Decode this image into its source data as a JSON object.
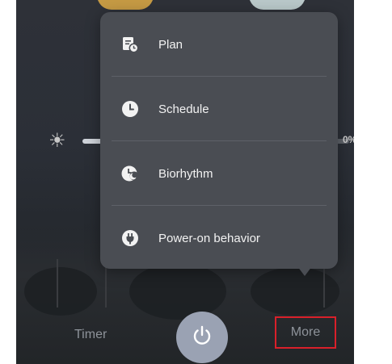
{
  "menu": {
    "items": [
      {
        "label": "Plan",
        "icon": "plan-icon"
      },
      {
        "label": "Schedule",
        "icon": "clock-icon"
      },
      {
        "label": "Biorhythm",
        "icon": "biorhythm-icon"
      },
      {
        "label": "Power-on behavior",
        "icon": "plug-icon"
      }
    ]
  },
  "brightness": {
    "percent_label": "0%",
    "level": 0.62,
    "icon": "sun-icon"
  },
  "bottom_bar": {
    "timer_label": "Timer",
    "more_label": "More",
    "power_icon": "power-icon"
  },
  "colors": {
    "menu_bg": "#4a4d53",
    "highlight_box": "#d9202a",
    "power_button": "#9aa2b3"
  }
}
